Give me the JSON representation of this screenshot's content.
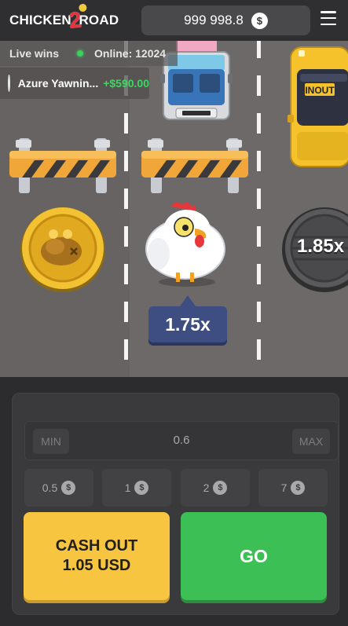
{
  "header": {
    "logo_left": "CHICKEN",
    "logo_digit": "2",
    "logo_right": "ROAD",
    "balance": "999 998.8",
    "currency_icon": "$",
    "menu_icon": "hamburger-menu-icon"
  },
  "live": {
    "label": "Live wins",
    "online": "Online: 12024",
    "online_color": "#39d15a"
  },
  "last_win": {
    "name": "Azure Yawnin...",
    "amount": "+$590.00"
  },
  "lanes": {
    "passed_tile": "coin-tile",
    "current_multiplier": "1.75x",
    "next_multiplier": "1.85x"
  },
  "bet": {
    "min_label": "MIN",
    "value": "0.6",
    "max_label": "MAX",
    "currency_icon": "$",
    "quick": [
      "0.5",
      "1",
      "2",
      "7"
    ]
  },
  "actions": {
    "cashout_line1": "CASH OUT",
    "cashout_line2": "1.05 USD",
    "go_label": "GO",
    "cashout_color": "#f7c540",
    "go_color": "#3cbf55"
  }
}
